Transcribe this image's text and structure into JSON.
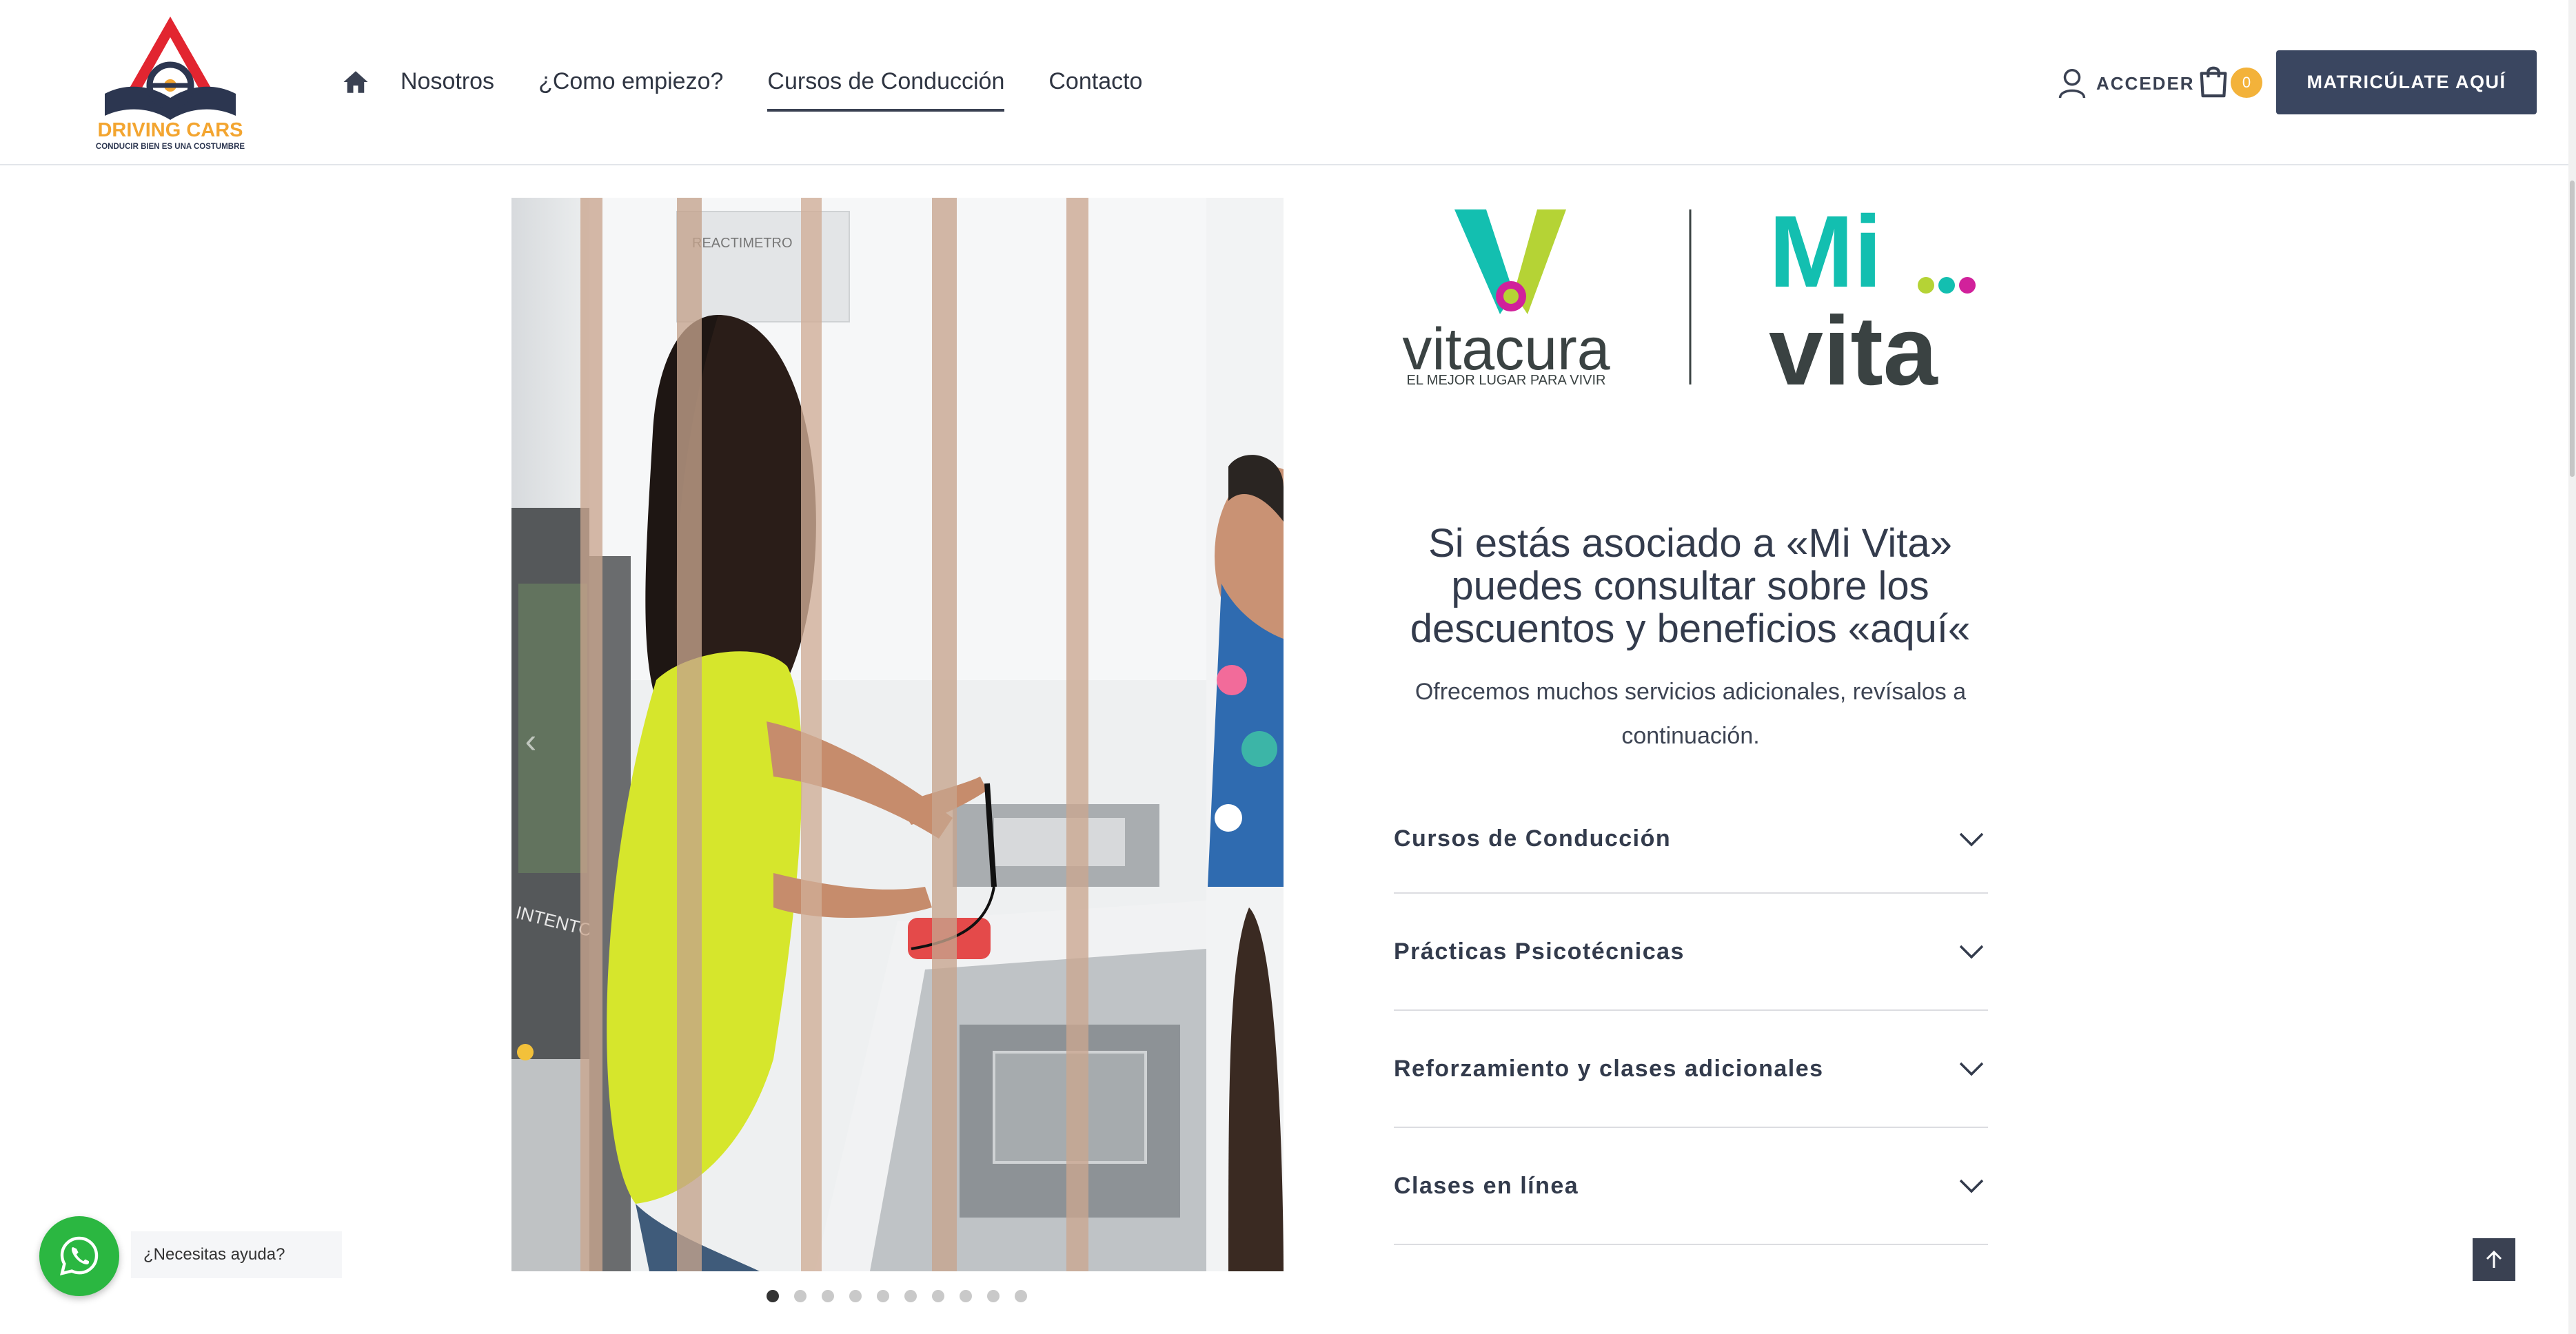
{
  "brand": {
    "name": "DRIVING CARS",
    "tagline": "CONDUCIR BIEN ES UNA COSTUMBRE"
  },
  "nav": {
    "items": [
      {
        "label": "Nosotros",
        "active": false
      },
      {
        "label": "¿Como empiezo?",
        "active": false
      },
      {
        "label": "Cursos de Conducción",
        "active": true
      },
      {
        "label": "Contacto",
        "active": false
      }
    ]
  },
  "account": {
    "login_label": "ACCEDER",
    "cart_count": "0",
    "cta_label": "MATRICÚLATE AQUÍ"
  },
  "partner": {
    "left_name": "vitacura",
    "left_tagline": "EL MEJOR LUGAR PARA VIVIR",
    "right_top": "Mi",
    "right_bottom": "vita"
  },
  "content": {
    "headline": "Si estás asociado a «Mi Vita» puedes consultar sobre los descuentos y beneficios «aquí«",
    "subtext": "Ofrecemos muchos servicios adicionales, revísalos a continuación."
  },
  "photo": {
    "device_label": "REACTIMETRO",
    "side_label": "INTENTOS"
  },
  "carousel": {
    "slide_count": 10,
    "active_index": 0
  },
  "accordion": [
    {
      "label": "Cursos de Conducción"
    },
    {
      "label": "Prácticas Psicotécnicas"
    },
    {
      "label": "Reforzamiento y clases adicionales"
    },
    {
      "label": "Clases en línea"
    }
  ],
  "whatsapp": {
    "tooltip": "¿Necesitas ayuda?"
  },
  "colors": {
    "primary": "#3a4660",
    "accent": "#f3b23a",
    "whatsapp": "#2bb741",
    "vitacura_teal": "#13bfb0",
    "vitacura_lime": "#b5d335",
    "vitacura_magenta": "#d1219b"
  },
  "icons": {
    "home": "home-icon",
    "user": "user-icon",
    "cart": "cart-icon",
    "chevron": "chevron-down-icon",
    "whatsapp": "whatsapp-icon",
    "top": "arrow-up-icon"
  }
}
